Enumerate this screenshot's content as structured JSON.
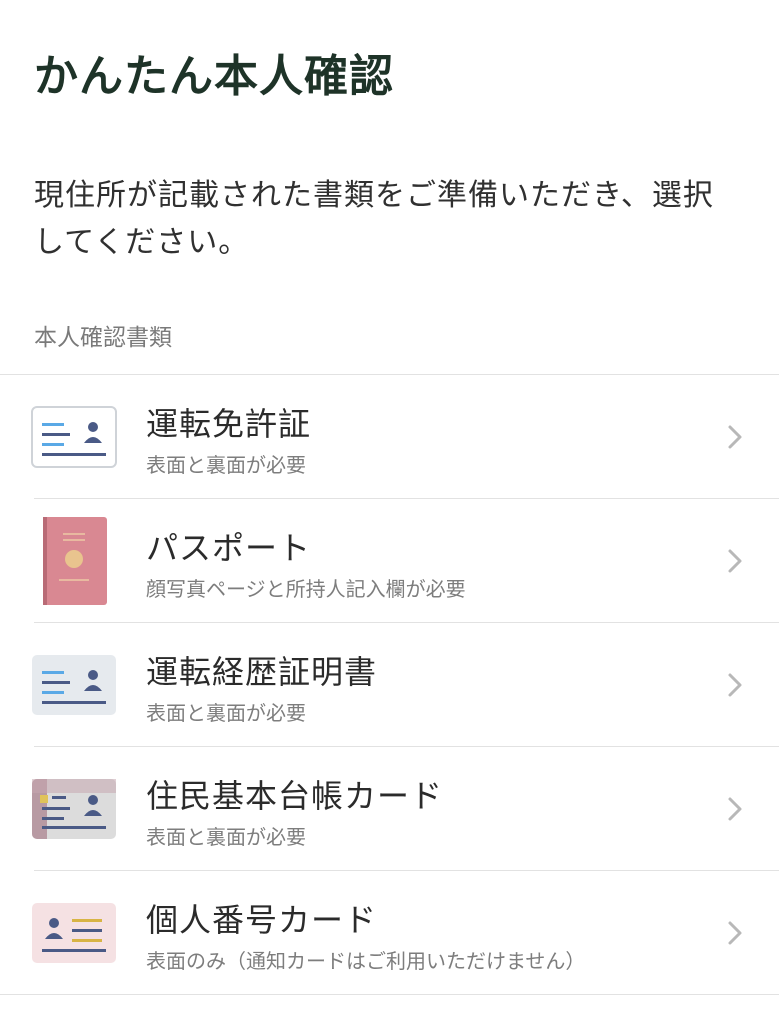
{
  "header": {
    "title": "かんたん本人確認"
  },
  "instruction": "現住所が記載された書類をご準備いただき、選択してください。",
  "section_label": "本人確認書類",
  "documents": [
    {
      "title": "運転免許証",
      "subtitle": "表面と裏面が必要",
      "icon": "drivers-license-icon"
    },
    {
      "title": "パスポート",
      "subtitle": "顔写真ページと所持人記入欄が必要",
      "icon": "passport-icon"
    },
    {
      "title": "運転経歴証明書",
      "subtitle": "表面と裏面が必要",
      "icon": "driving-record-certificate-icon"
    },
    {
      "title": "住民基本台帳カード",
      "subtitle": "表面と裏面が必要",
      "icon": "resident-registry-card-icon"
    },
    {
      "title": "個人番号カード",
      "subtitle": "表面のみ（通知カードはご利用いただけません）",
      "icon": "my-number-card-icon"
    }
  ],
  "colors": {
    "title": "#1e3328",
    "passport": "#d98892",
    "card_blue": "#5aa9e6",
    "card_navy": "#4a5a86",
    "my_number_gold": "#d8b445",
    "chevron": "#b8b8b8",
    "divider": "#e2e2e2"
  }
}
